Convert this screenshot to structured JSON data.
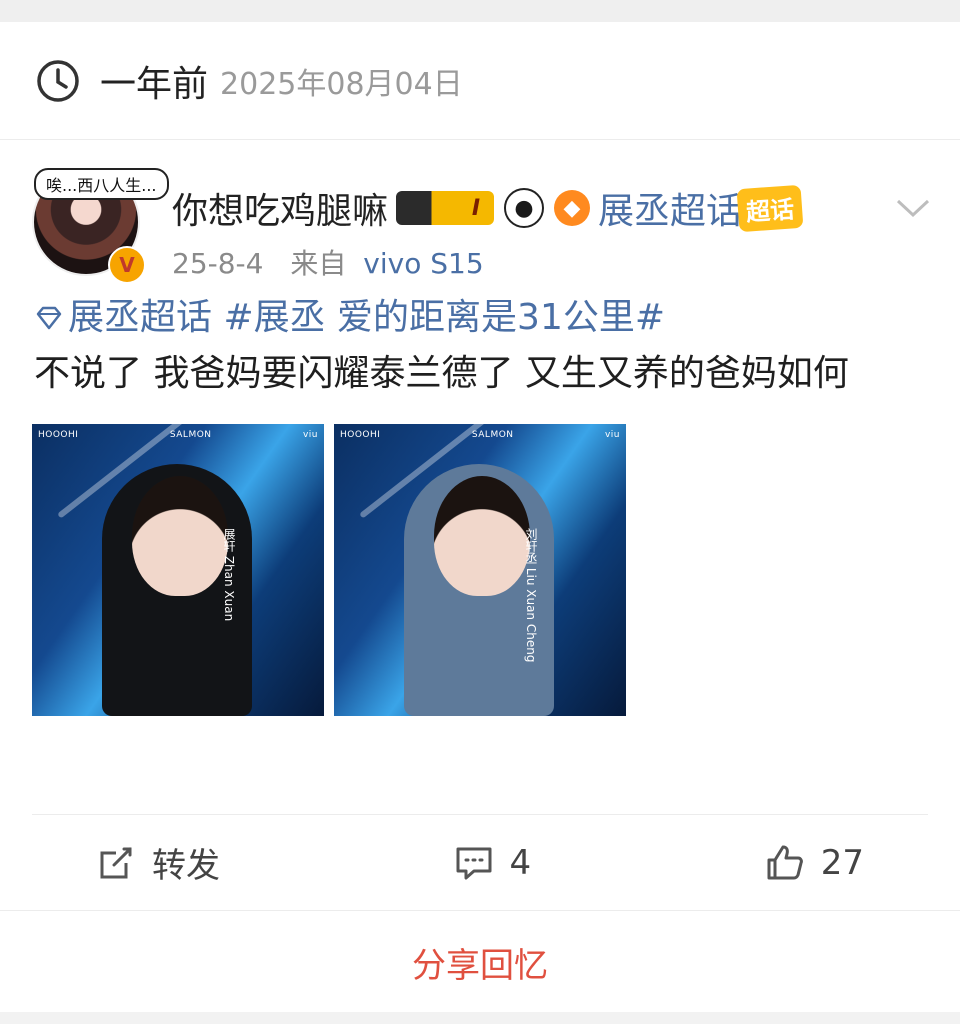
{
  "memory": {
    "ago": "一年前",
    "date": "2025年08月04日"
  },
  "post": {
    "avatar_bubble": "唉...西八人生...",
    "vip_badge": "V",
    "username": "你想吃鸡腿嘛",
    "level_badge": "I",
    "topic": "展丞超话",
    "chaohua_tag": "超话",
    "time": "25-8-4",
    "from_label": "来自",
    "device": "vivo S15",
    "tags": "展丞超话 #展丞 爱的距离是31公里#",
    "text": "不说了 我爸妈要闪耀泰兰德了 又生又养的爸妈如何",
    "images": [
      {
        "logos": [
          "HOOOHI",
          "SALMON",
          "viu"
        ],
        "name": "展轩 Zhan Xuan"
      },
      {
        "logos": [
          "HOOOHI",
          "SALMON",
          "viu"
        ],
        "name": "刘轩丞 Liu Xuan Cheng"
      }
    ]
  },
  "actions": {
    "repost_label": "转发",
    "comment_count": "4",
    "like_count": "27"
  },
  "share_label": "分享回忆",
  "colors": {
    "link": "#4a6fa5",
    "share": "#e0503f",
    "badge": "#ffbe1a"
  },
  "icons": [
    "clock-icon",
    "chevron-down-icon",
    "diamond-icon",
    "repost-icon",
    "comment-icon",
    "like-icon"
  ]
}
